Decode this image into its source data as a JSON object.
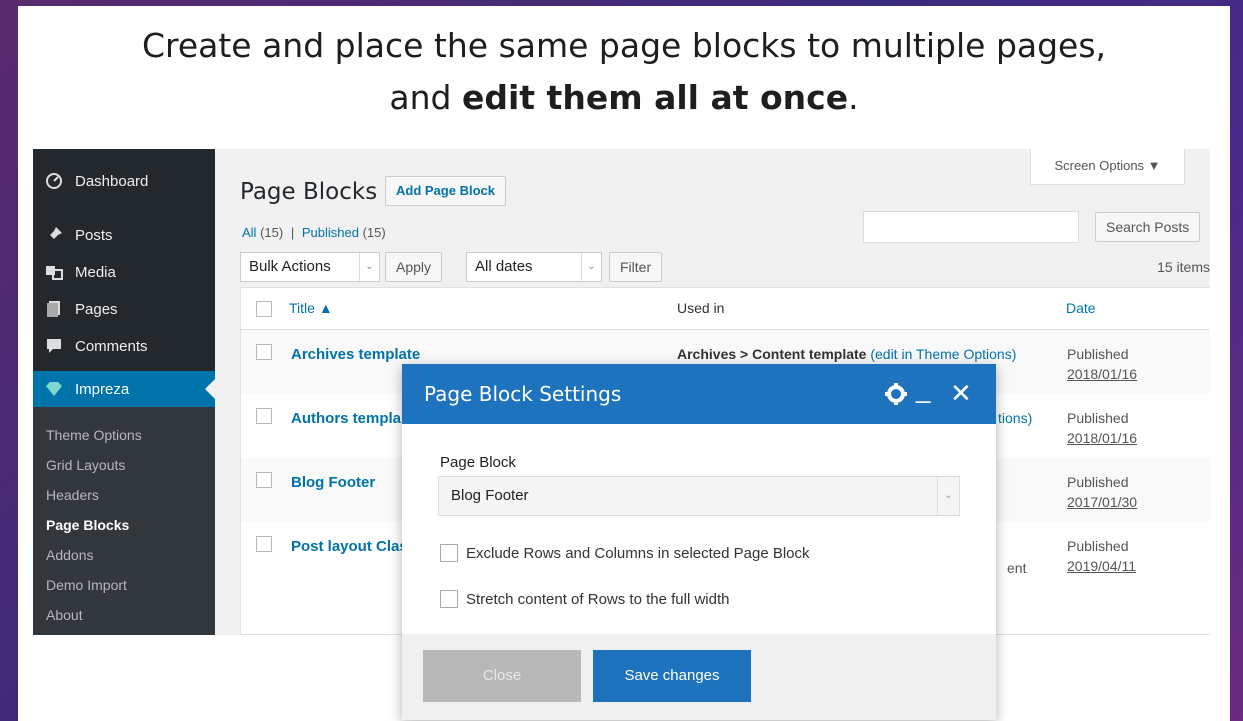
{
  "headline": {
    "line1": "Create and place the same page blocks to multiple pages,",
    "line2_prefix": "and ",
    "line2_bold": "edit them all at once",
    "line2_suffix": "."
  },
  "sidebar": {
    "items": [
      {
        "label": "Dashboard",
        "icon": "dashboard-icon"
      },
      {
        "label": "Posts",
        "icon": "pin-icon"
      },
      {
        "label": "Media",
        "icon": "media-icon"
      },
      {
        "label": "Pages",
        "icon": "pages-icon"
      },
      {
        "label": "Comments",
        "icon": "comment-icon"
      },
      {
        "label": "Impreza",
        "icon": "diamond-icon"
      }
    ],
    "submenu": [
      "Theme Options",
      "Grid Layouts",
      "Headers",
      "Page Blocks",
      "Addons",
      "Demo Import",
      "About"
    ]
  },
  "main": {
    "title": "Page Blocks",
    "add_button": "Add Page Block",
    "screen_options": "Screen Options ▼",
    "filters": {
      "all": "All",
      "all_count": "(15)",
      "sep": "|",
      "published": "Published",
      "published_count": "(15)"
    },
    "search_button": "Search Posts",
    "bulk_actions": "Bulk Actions",
    "apply": "Apply",
    "dates": "All dates",
    "filter": "Filter",
    "items_count": "15 items",
    "columns": {
      "title": "Title ▲",
      "used_in": "Used in",
      "date": "Date"
    },
    "rows": [
      {
        "title": "Archives template",
        "used_in": "Archives > Content template",
        "used_link": "(edit in Theme Options)",
        "status": "Published",
        "date": "2018/01/16"
      },
      {
        "title": "Authors templa",
        "used_frag": "tions)",
        "status": "Published",
        "date": "2018/01/16"
      },
      {
        "title": "Blog Footer",
        "status": "Published",
        "date": "2017/01/30"
      },
      {
        "title": "Post layout Clas",
        "used_frag": "ent",
        "status": "Published",
        "date": "2019/04/11"
      }
    ]
  },
  "modal": {
    "title": "Page Block Settings",
    "field_label": "Page Block",
    "field_value": "Blog Footer",
    "check1": "Exclude Rows and Columns in selected Page Block",
    "check2": "Stretch content of Rows to the full width",
    "close": "Close",
    "save": "Save changes"
  },
  "colors": {
    "accent": "#1e73be",
    "sidebar": "#23282d",
    "active": "#0073aa"
  }
}
